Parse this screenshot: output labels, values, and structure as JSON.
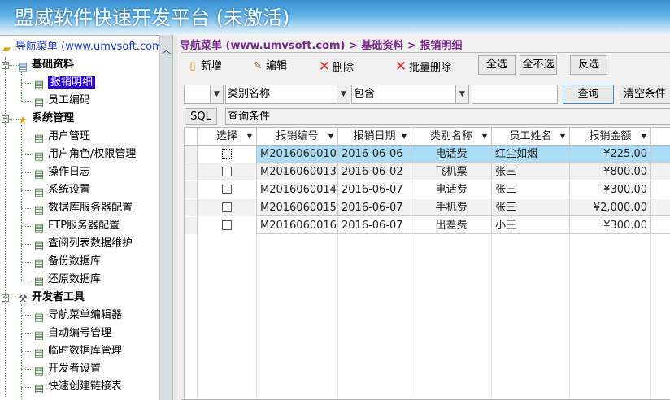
{
  "title": "盟威软件快速开发平台 (未激活)",
  "sidebar": {
    "root": "导航菜单 (www.umvsoft.com)",
    "groups": [
      {
        "label": "基础资料",
        "items": [
          "报销明细",
          "员工编码"
        ]
      },
      {
        "label": "系统管理",
        "items": [
          "用户管理",
          "用户角色/权限管理",
          "操作日志",
          "系统设置",
          "数据库服务器配置",
          "FTP服务器配置",
          "查阅列表数据维护",
          "备份数据库",
          "还原数据库"
        ]
      },
      {
        "label": "开发者工具",
        "items": [
          "导航菜单编辑器",
          "自动编号管理",
          "临时数据库管理",
          "开发者设置",
          "快速创建链接表"
        ]
      }
    ],
    "selected": "报销明细"
  },
  "breadcrumb": "导航菜单 (www.umvsoft.com) > 基础资料 > 报销明细",
  "toolbar": {
    "add": "新增",
    "edit": "编辑",
    "delete": "删除",
    "batch_delete": "批量删除",
    "select_all": "全选",
    "select_none": "全不选",
    "invert": "反选"
  },
  "filter": {
    "logic": "",
    "field": "类别名称",
    "operator": "包含",
    "value": "",
    "query": "查询",
    "clear": "清空条件",
    "sql": "SQL",
    "condition": "查询条件"
  },
  "grid": {
    "columns": [
      "选择",
      "报销编号",
      "报销日期",
      "类别名称",
      "员工姓名",
      "报销金额"
    ],
    "rows": [
      {
        "id": "M2016060010",
        "date": "2016-06-06",
        "category": "电话费",
        "name": "红尘如烟",
        "amount": "¥225.00",
        "selected": true
      },
      {
        "id": "M2016060013",
        "date": "2016-06-02",
        "category": "飞机票",
        "name": "张三",
        "amount": "¥800.00"
      },
      {
        "id": "M2016060014",
        "date": "2016-06-07",
        "category": "电话费",
        "name": "张三",
        "amount": "¥300.00"
      },
      {
        "id": "M2016060015",
        "date": "2016-06-07",
        "category": "手机费",
        "name": "张三",
        "amount": "¥2,000.00"
      },
      {
        "id": "M2016060016",
        "date": "2016-06-07",
        "category": "出差费",
        "name": "小王",
        "amount": "¥300.00"
      }
    ]
  },
  "colors": {
    "selected_row": "#aadcf5",
    "selected_tree": "#2b00e0",
    "breadcrumb": "#7a2c8c"
  }
}
